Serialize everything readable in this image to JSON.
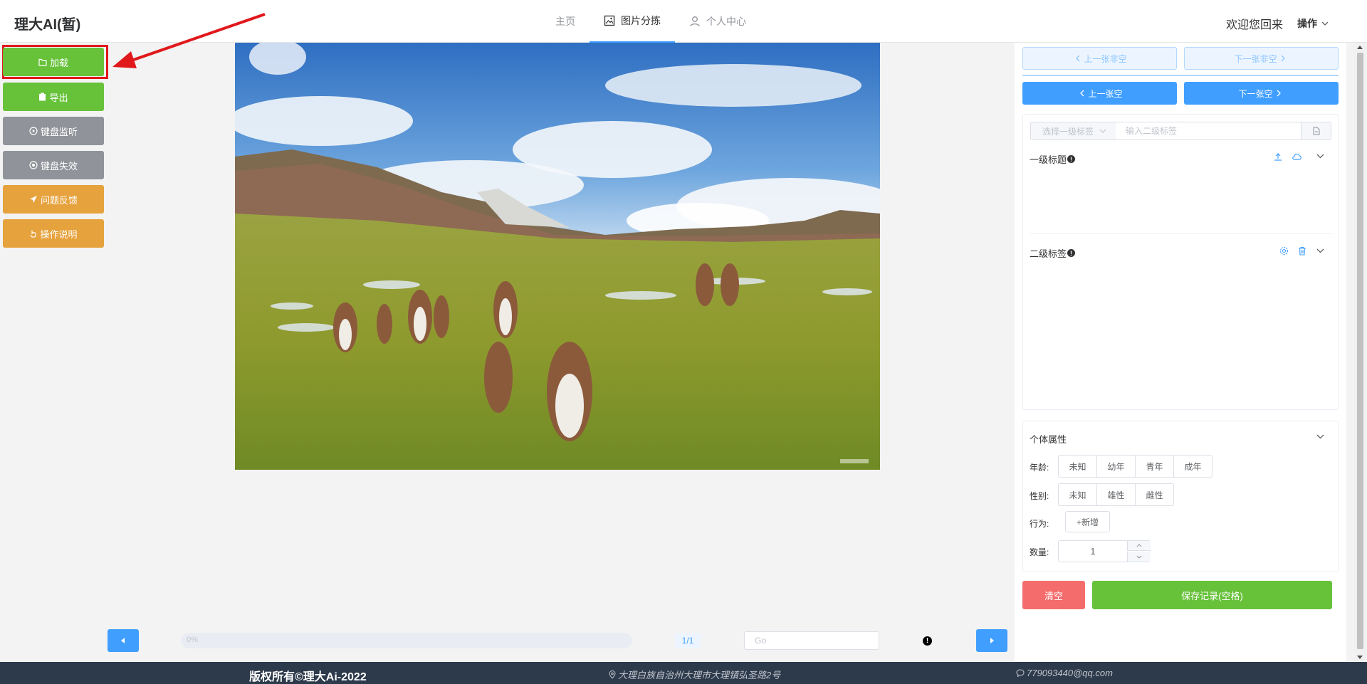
{
  "header": {
    "logo": "理大AI(暂)",
    "nav": [
      {
        "label": "主页"
      },
      {
        "label": "图片分拣"
      },
      {
        "label": "个人中心"
      }
    ],
    "welcome": "欢迎您回来",
    "ops_label": "操作"
  },
  "left_buttons": {
    "load": "加载",
    "export": "导出",
    "kb_listen": "键盘监听",
    "kb_disable": "键盘失效",
    "feedback": "问题反馈",
    "instructions": "操作说明"
  },
  "pager": {
    "progress_text": "0%",
    "progress_value": 0,
    "page_count": "1/1",
    "go_placeholder": "Go"
  },
  "right_panel": {
    "prev_nonempty": "上一张非空",
    "next_nonempty": "下一张非空",
    "prev_empty": "上一张空",
    "next_empty": "下一张空",
    "select_primary_placeholder": "选择一级标签",
    "secondary_input_placeholder": "输入二级标签",
    "primary_title": "一级标题",
    "secondary_title": "二级标签",
    "attributes_title": "个体属性",
    "age_label": "年龄:",
    "age_options": [
      "未知",
      "幼年",
      "青年",
      "成年"
    ],
    "gender_label": "性别:",
    "gender_options": [
      "未知",
      "雄性",
      "雌性"
    ],
    "behavior_label": "行为:",
    "add_label": "+新增",
    "count_label": "数量:",
    "count_value": "1",
    "clear_label": "清空",
    "save_label": "保存记录(空格)"
  },
  "footer": {
    "copyright": "版权所有©理大Ai-2022",
    "address": "大理白族自治州大理市大理镇弘圣路2号",
    "email": "779093440@qq.com"
  },
  "colors": {
    "primary": "#409eff",
    "success": "#67c23a",
    "warning": "#e6a23c",
    "info": "#909399",
    "danger": "#f56c6c",
    "footer_bg": "#2d3a4b"
  }
}
